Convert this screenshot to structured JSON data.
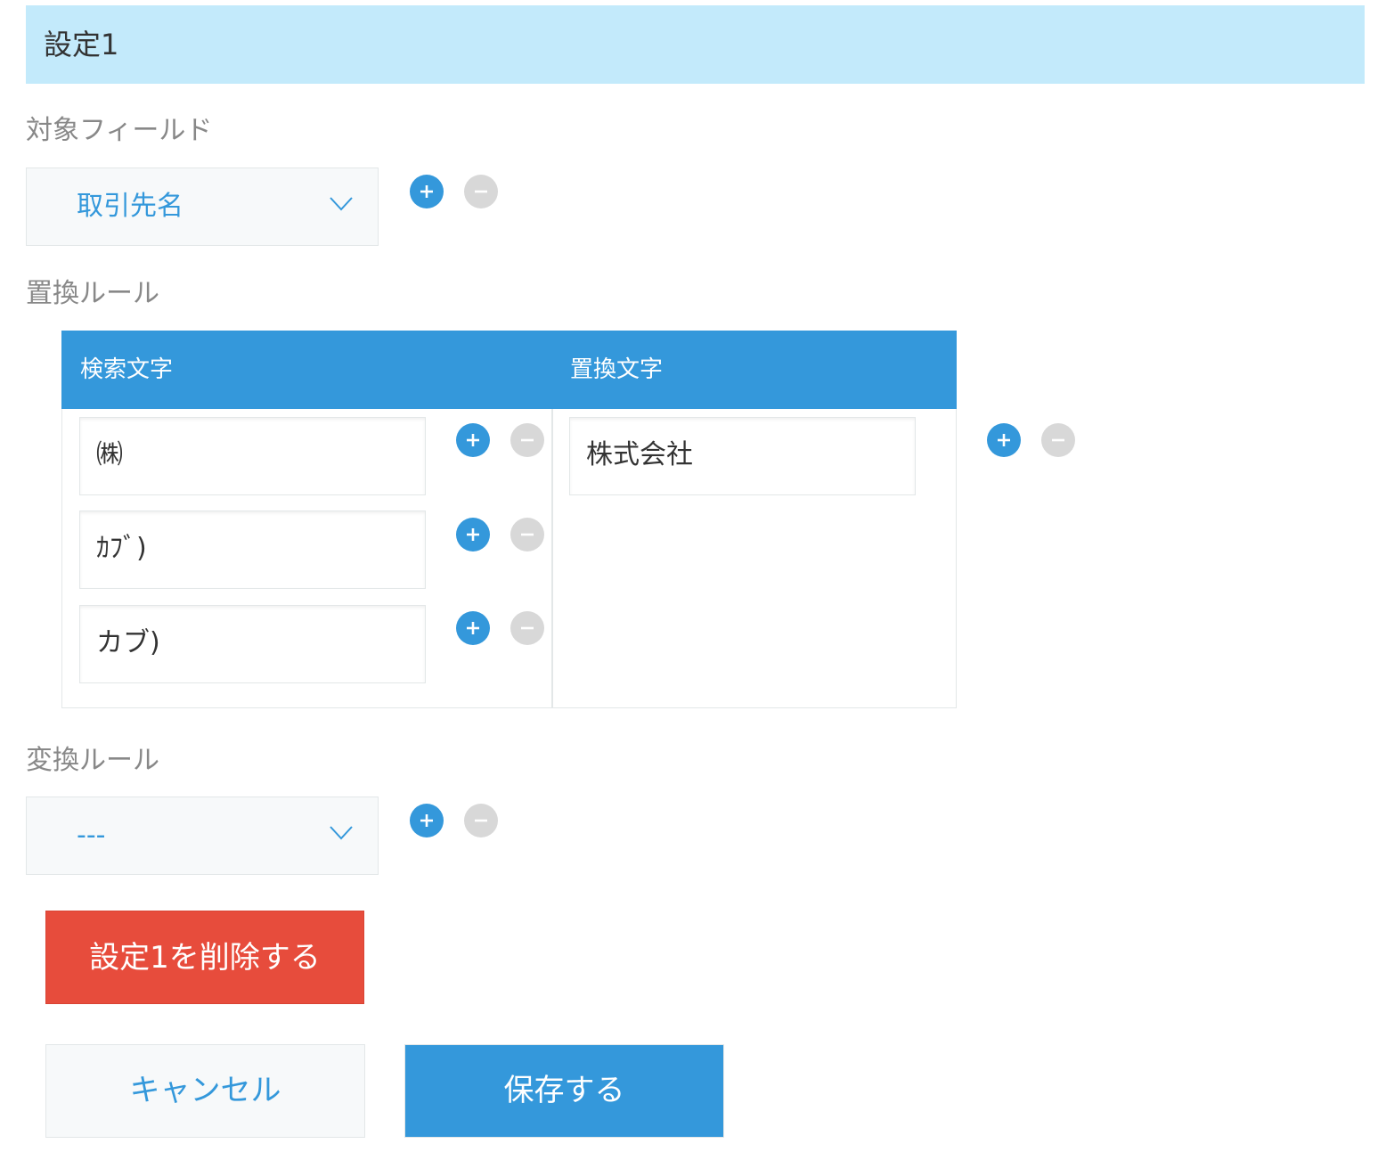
{
  "setting": {
    "title": "設定1",
    "target_field": {
      "label": "対象フィールド",
      "selected": "取引先名"
    },
    "replace_rule": {
      "label": "置換ルール",
      "header_search": "検索文字",
      "header_replace": "置換文字",
      "search_values": [
        "㈱",
        "ｶﾌﾞ)",
        "カブ)"
      ],
      "replace_value": "株式会社"
    },
    "convert_rule": {
      "label": "変換ルール",
      "selected": "---"
    },
    "delete_label": "設定1を削除する"
  },
  "footer": {
    "cancel_label": "キャンセル",
    "save_label": "保存する"
  },
  "colors": {
    "accent": "#3498db",
    "header_bg": "#c3eafb",
    "danger": "#e74c3c",
    "disabled": "#d8d8d8"
  },
  "icons": [
    "plus-circle-icon",
    "minus-circle-icon",
    "chevron-down-icon"
  ]
}
